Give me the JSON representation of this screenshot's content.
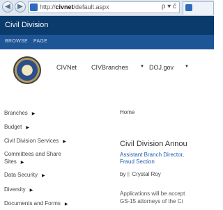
{
  "browser": {
    "url_prefix": "http://",
    "url_host": "civnet",
    "url_path": "/default.aspx",
    "address_tools": "ρ ▾ ć"
  },
  "suite": {
    "site_title": "Civil Division",
    "tabs": [
      "BROWSE",
      "PAGE"
    ]
  },
  "top_nav": {
    "items": [
      "CIVNet",
      "CIVBranches",
      "DOJ.gov"
    ]
  },
  "left_nav": {
    "items": [
      "Branches",
      "Budget",
      "Civil Division Services",
      "Committees and Share\nSites",
      "Data Security",
      "Diversity",
      "Documents and Forms"
    ]
  },
  "main": {
    "breadcrumb": "Home",
    "announcement": {
      "title": "Civil Division Annou",
      "link_line1": "Assistant Branch Director,",
      "link_line2": "Fraud Section",
      "by_prefix": "by",
      "author": "Crystal Roy",
      "body_line1": "Applications will be accept",
      "body_line2": "GS-15 attorneys of the Ci"
    }
  }
}
